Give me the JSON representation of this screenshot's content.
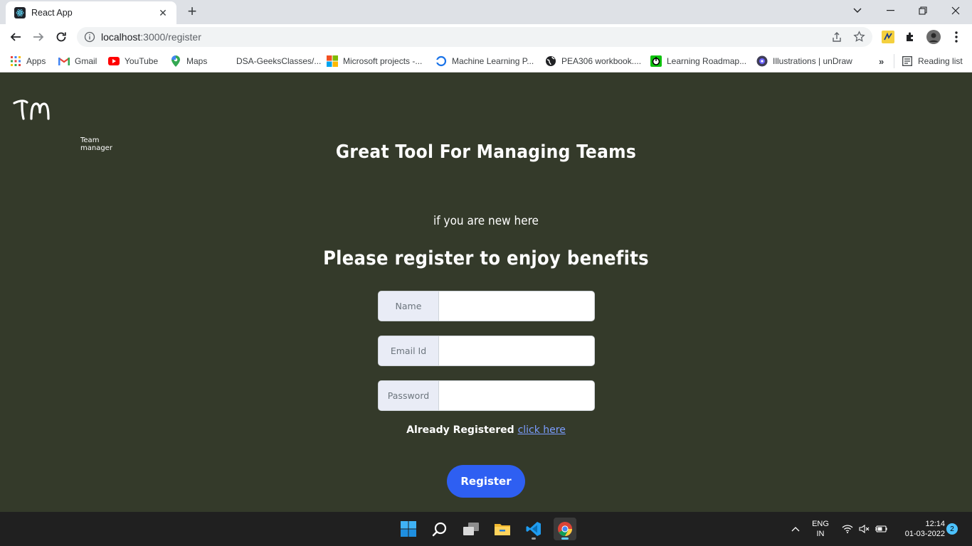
{
  "browser": {
    "tab_title": "React App",
    "url_host": "localhost",
    "url_path": ":3000/register",
    "bookmarks": [
      {
        "label": "Apps",
        "icon": "apps-grid-icon"
      },
      {
        "label": "Gmail",
        "icon": "gmail-icon"
      },
      {
        "label": "YouTube",
        "icon": "youtube-icon"
      },
      {
        "label": "Maps",
        "icon": "maps-icon"
      },
      {
        "label": "DSA-GeeksClasses/...",
        "icon": "bookmark-icon"
      },
      {
        "label": "Microsoft projects -...",
        "icon": "microsoft-icon"
      },
      {
        "label": "Machine Learning P...",
        "icon": "ml-icon"
      },
      {
        "label": "PEA306 workbook....",
        "icon": "globe-icon"
      },
      {
        "label": "Learning Roadmap...",
        "icon": "roadmap-icon"
      },
      {
        "label": "Illustrations | unDraw",
        "icon": "undraw-icon"
      }
    ],
    "more_bookmarks": "»",
    "reading_list": "Reading list"
  },
  "page": {
    "logo_text": "TM",
    "logo_subtitle": "Team manager",
    "headline": "Great Tool For Managing Teams",
    "subheadline": "if you are new here",
    "register_heading": "Please register to enjoy benefits",
    "fields": {
      "name_label": "Name",
      "email_label": "Email Id",
      "password_label": "Password"
    },
    "already_text": "Already Registered",
    "login_link": "click here",
    "register_button": "Register",
    "colors": {
      "background": "#343a2a",
      "button": "#2e5ff2",
      "link": "#7b9dff"
    }
  },
  "taskbar": {
    "language": "ENG",
    "region": "IN",
    "time": "12:14",
    "date": "01-03-2022",
    "notifications": "2"
  }
}
